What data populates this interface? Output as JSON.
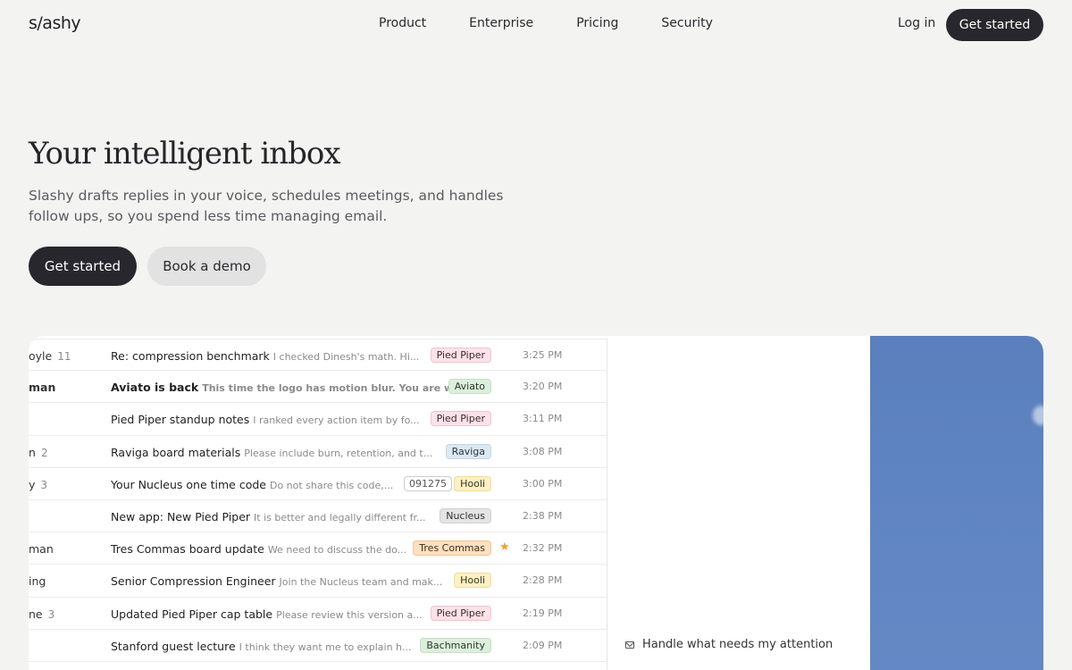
{
  "nav": {
    "logo": "s/ashy",
    "links": [
      "Product",
      "Enterprise",
      "Pricing",
      "Security"
    ],
    "login": "Log in",
    "cta": "Get started"
  },
  "hero": {
    "title": "Your intelligent inbox",
    "subtitle": "Slashy drafts replies in your voice, schedules meetings, and handles follow ups, so you spend less time managing email.",
    "primary_button": "Get started",
    "secondary_button": "Book a demo"
  },
  "emails": [
    {
      "sender": "oyle",
      "count": "11",
      "bold": false,
      "subject": "Re: compression benchmark",
      "preview": "I checked Dinesh's math. Hi...",
      "tag": "Pied Piper",
      "time": "3:25 PM"
    },
    {
      "sender": "man",
      "count": "",
      "bold": true,
      "subject": "Aviato is back",
      "preview": "This time the logo has motion blur. You are w...",
      "tag": "Aviato",
      "time": "3:20 PM"
    },
    {
      "sender": "",
      "count": "",
      "bold": false,
      "subject": "Pied Piper standup notes",
      "preview": "I ranked every action item by fo...",
      "tag": "Pied Piper",
      "time": "3:11 PM"
    },
    {
      "sender": "n",
      "count": "2",
      "bold": false,
      "subject": "Raviga board materials",
      "preview": "Please include burn, retention, and t...",
      "tag": "Raviga",
      "time": "3:08 PM"
    },
    {
      "sender": "y",
      "count": "3",
      "bold": false,
      "subject": "Your Nucleus one time code",
      "preview": "Do not share this code,...",
      "code": "091275",
      "tag": "Hooli",
      "time": "3:00 PM"
    },
    {
      "sender": "",
      "count": "",
      "bold": false,
      "subject": "New app: New Pied Piper",
      "preview": "It is better and legally different fr...",
      "tag": "Nucleus",
      "time": "2:38 PM"
    },
    {
      "sender": "man",
      "count": "",
      "bold": false,
      "subject": "Tres Commas board update",
      "preview": "We need to discuss the do...",
      "tag": "Tres Commas",
      "starred": true,
      "time": "2:32 PM"
    },
    {
      "sender": "ing",
      "count": "",
      "bold": false,
      "subject": "Senior Compression Engineer",
      "preview": "Join the Nucleus team and mak...",
      "tag": "Hooli",
      "time": "2:28 PM"
    },
    {
      "sender": "ne",
      "count": "3",
      "bold": false,
      "subject": "Updated Pied Piper cap table",
      "preview": "Please review this version a...",
      "tag": "Pied Piper",
      "time": "2:19 PM"
    },
    {
      "sender": "",
      "count": "",
      "bold": false,
      "subject": "Stanford guest lecture",
      "preview": "I think they want me to explain h...",
      "tag": "Bachmanity",
      "time": "2:09 PM"
    }
  ],
  "tag_colors": {
    "Pied Piper": {
      "bg": "#fbe3e8",
      "fg": "#3a2a30",
      "border": "#f1c3cf"
    },
    "Aviato": {
      "bg": "#dcefdc",
      "fg": "#2b3a2b",
      "border": "#c4e0c4"
    },
    "Raviga": {
      "bg": "#dce8f2",
      "fg": "#2a3440",
      "border": "#c2d6e6"
    },
    "Hooli": {
      "bg": "#fdf0c4",
      "fg": "#3d3520",
      "border": "#f1dc98"
    },
    "Nucleus": {
      "bg": "#e4e4e4",
      "fg": "#333333",
      "border": "#cfcfcf"
    },
    "Tres Commas": {
      "bg": "#fde0c0",
      "fg": "#3d2e1c",
      "border": "#f3c490"
    },
    "Bachmanity": {
      "bg": "#dcefdc",
      "fg": "#2b3a2b",
      "border": "#c4e0c4"
    }
  },
  "attention": "Handle what needs my attention"
}
